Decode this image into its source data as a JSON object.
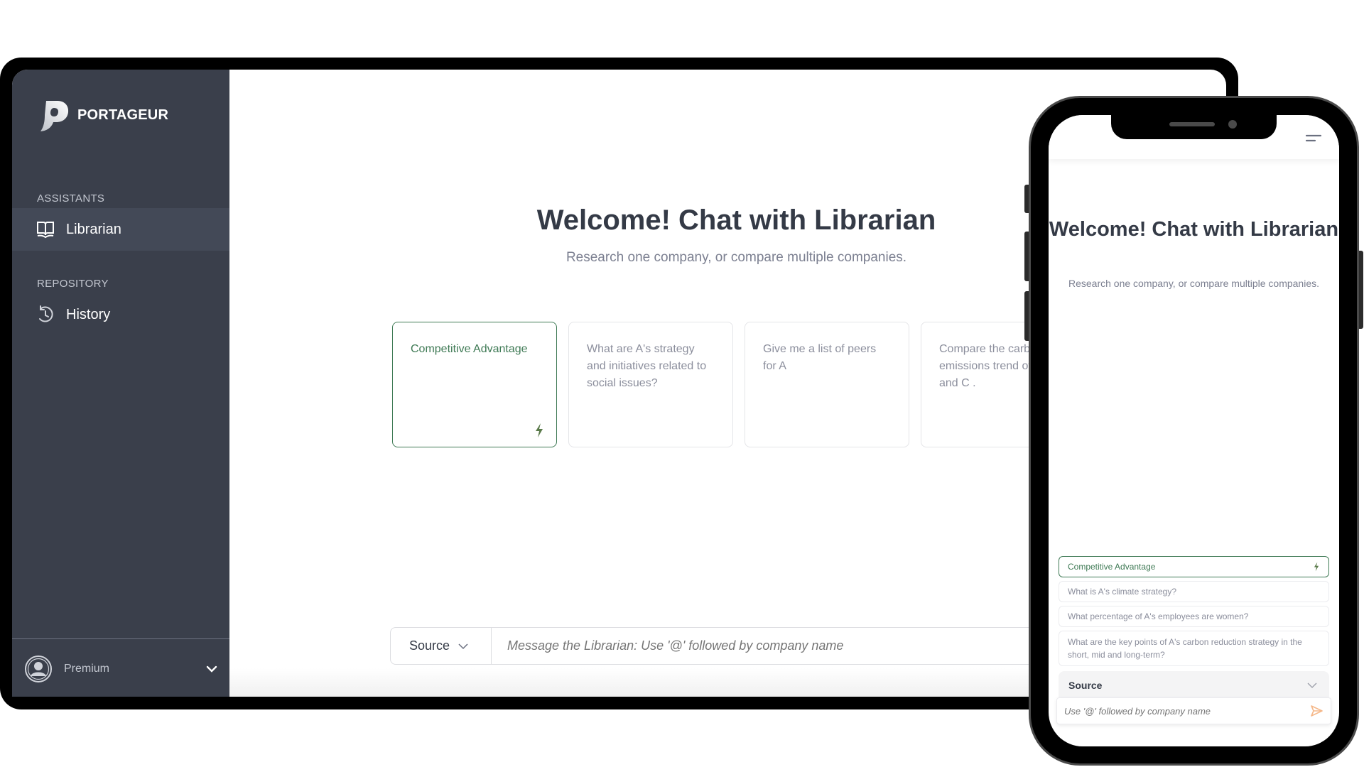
{
  "brand": {
    "name": "PORTAGEUR"
  },
  "sidebar": {
    "sections": [
      {
        "label": "ASSISTANTS",
        "items": [
          {
            "label": "Librarian",
            "icon": "book-open-icon",
            "active": true
          }
        ]
      },
      {
        "label": "REPOSITORY",
        "items": [
          {
            "label": "History",
            "icon": "history-icon",
            "active": false
          }
        ]
      }
    ],
    "user": {
      "plan": "Premium",
      "icon": "user-avatar-icon"
    }
  },
  "main": {
    "title": "Welcome! Chat with Librarian",
    "subtitle": "Research one company, or compare multiple companies.",
    "cards": [
      {
        "text": "Competitive Advantage",
        "active": true,
        "icon": "bolt-icon"
      },
      {
        "text": "What are A's strategy and initiatives related to social issues?",
        "active": false
      },
      {
        "text": "Give me a list of peers for A",
        "active": false
      },
      {
        "text": "Compare the carbon emissions trend of A, B and C .",
        "active": false
      }
    ],
    "source_label": "Source",
    "input_placeholder": "Message the Librarian: Use '@' followed by company name"
  },
  "mobile": {
    "title": "Welcome! Chat with Librarian",
    "subtitle": "Research one company, or compare multiple companies.",
    "suggestions": [
      {
        "text": "Competitive Advantage",
        "active": true
      },
      {
        "text": "What is A's climate strategy?",
        "active": false
      },
      {
        "text": "What percentage of A's employees are women?",
        "active": false
      },
      {
        "text": "What are the key points of A's carbon reduction strategy in the short, mid and long-term?",
        "active": false
      }
    ],
    "source_label": "Source",
    "input_placeholder": "Use '@' followed by company name"
  },
  "colors": {
    "sidebar_bg": "#3a3f4b",
    "sidebar_active": "#434957",
    "accent_green": "#3f7a55",
    "send_orange": "#f5b88a",
    "title_text": "#343a46"
  }
}
